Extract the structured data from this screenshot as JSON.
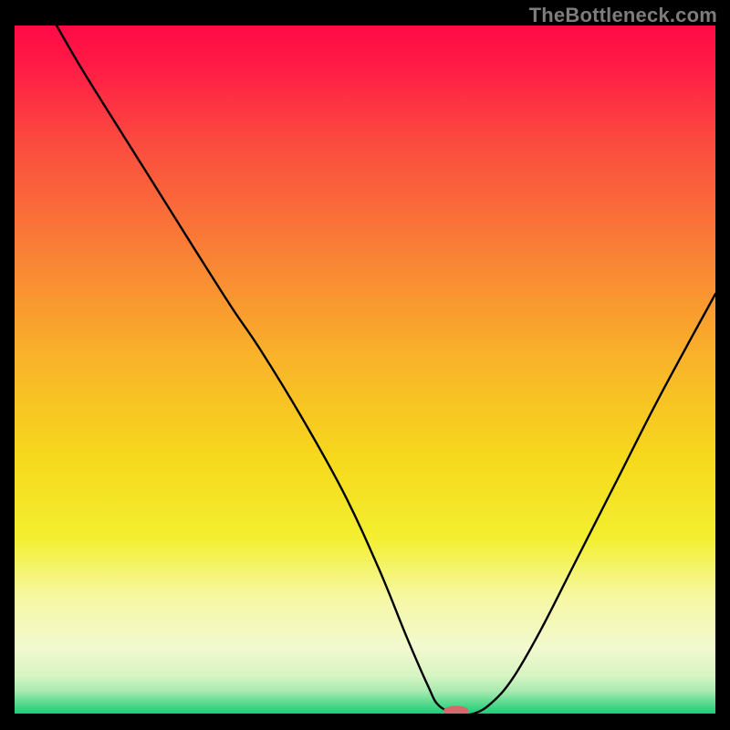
{
  "watermark": "TheBottleneck.com",
  "chart_data": {
    "type": "line",
    "title": "",
    "xlabel": "",
    "ylabel": "",
    "xlim": [
      0,
      100
    ],
    "ylim": [
      0,
      100
    ],
    "grid": false,
    "legend": false,
    "gradient_stops": [
      {
        "pos": 0.0,
        "color": "#ff0a47"
      },
      {
        "pos": 0.06,
        "color": "#ff1c46"
      },
      {
        "pos": 0.17,
        "color": "#fb4b3f"
      },
      {
        "pos": 0.32,
        "color": "#f97d36"
      },
      {
        "pos": 0.48,
        "color": "#f9b22a"
      },
      {
        "pos": 0.63,
        "color": "#f6d91c"
      },
      {
        "pos": 0.745,
        "color": "#f3ef30"
      },
      {
        "pos": 0.83,
        "color": "#f6f8a3"
      },
      {
        "pos": 0.905,
        "color": "#f2f9cf"
      },
      {
        "pos": 0.945,
        "color": "#d6f4c2"
      },
      {
        "pos": 0.968,
        "color": "#a6eab0"
      },
      {
        "pos": 0.985,
        "color": "#57da8d"
      },
      {
        "pos": 1.0,
        "color": "#18cf79"
      }
    ],
    "minimum_marker": {
      "x": 63,
      "y": 0,
      "color": "#d26a6a",
      "rx": 1.8,
      "ry": 0.7
    },
    "series": [
      {
        "name": "bottleneck-curve",
        "color": "#000000",
        "x": [
          6,
          10,
          18,
          26,
          31,
          35,
          41,
          47,
          52,
          56,
          59,
          60.5,
          63,
          65.5,
          68,
          71,
          75,
          80,
          86,
          92,
          100
        ],
        "y": [
          100,
          93,
          80,
          67,
          59,
          53,
          43,
          32,
          21,
          11,
          4,
          1.2,
          0,
          0,
          1.5,
          5,
          12,
          22,
          34,
          46,
          61
        ]
      }
    ]
  }
}
